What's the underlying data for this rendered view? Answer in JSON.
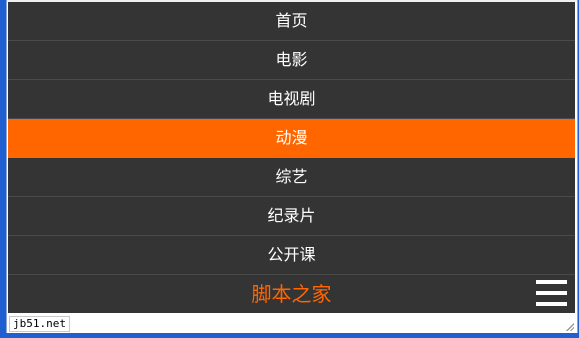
{
  "menu": {
    "items": [
      {
        "label": "首页"
      },
      {
        "label": "电影"
      },
      {
        "label": "电视剧"
      },
      {
        "label": "动漫",
        "active": true
      },
      {
        "label": "综艺"
      },
      {
        "label": "纪录片"
      },
      {
        "label": "公开课"
      }
    ]
  },
  "footer": {
    "brand": "脚本之家",
    "menu_icon": "hamburger-menu-icon"
  },
  "watermark": "jb51.net",
  "colors": {
    "accent": "#ff6600",
    "bar_background": "#343434",
    "text": "#ffffff"
  }
}
